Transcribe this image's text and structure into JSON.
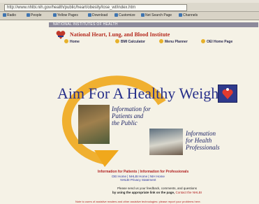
{
  "browser": {
    "address": "http://www.nhlbi.nih.gov/health/public/heart/obesity/lose_wt/index.htm",
    "links": [
      "Radio",
      "People",
      "Yellow Pages",
      "Download",
      "Customize",
      "Net Search Page",
      "Channels"
    ]
  },
  "site": {
    "nih_bar": "NATIONAL INSTITUTES OF HEALTH",
    "institute": "National Heart, Lung, and Blood Institute",
    "nav": [
      "Home",
      "BMI Calculator",
      "Menu Planner",
      "OEI Home Page"
    ]
  },
  "hero": {
    "title": "Aim For A Healthy Weight",
    "patients_text": "Information for\nPatients and\nthe Public",
    "professionals_text": "Information\nfor Health\nProfessionals"
  },
  "links": {
    "patients": "Information for Patients",
    "separator": "|",
    "professionals": "Information for Professionals",
    "sub_line1": "OEI Home | NHLBI Home | NIH Home",
    "sub_line2": "NHLBI Privacy Statement"
  },
  "feedback": {
    "line1": "Please send us your feedback, comments, and questions",
    "line2_prefix": "by using the appropriate link on the page,",
    "line2_link": "Contact the NHLBI"
  },
  "bottom_note": "Note to users of assistive readers and other assistive technologies: please report your problems here."
}
